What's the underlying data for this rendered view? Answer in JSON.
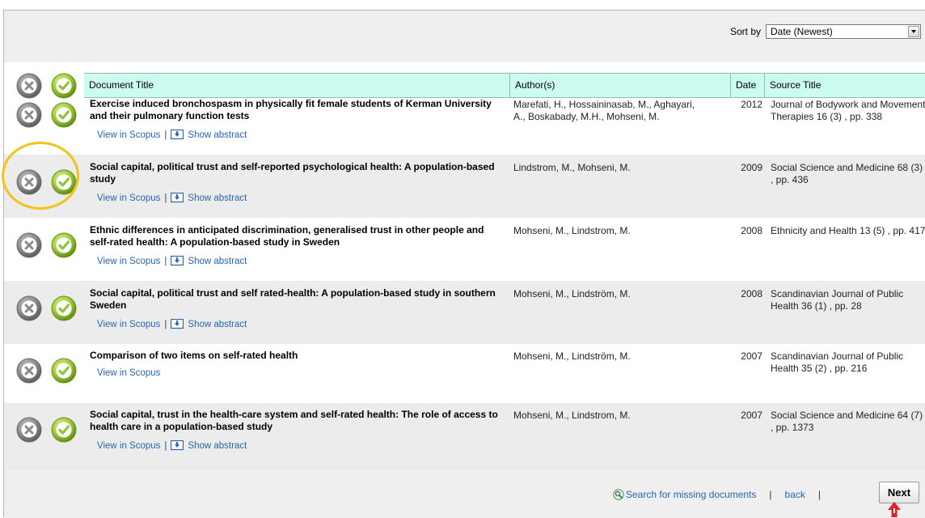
{
  "toolbar": {
    "sort_label": "Sort by",
    "sort_value": "Date (Newest)"
  },
  "table": {
    "headers": {
      "document_title": "Document Title",
      "authors": "Author(s)",
      "date": "Date",
      "source_title": "Source Title"
    },
    "rows": [
      {
        "title": "Exercise induced bronchospasm in physically fit female students of Kerman University and their pulmonary function tests",
        "authors": "Marefati, H., Hossaininasab, M., Aghayari, A., Boskabady, M.H., Mohseni, M.",
        "date": "2012",
        "source": "Journal of Bodywork and Movement Therapies 16 (3) , pp. 338",
        "view_link": "View in Scopus",
        "separator": "|",
        "abstract_link": "Show abstract"
      },
      {
        "title": "Social capital, political trust and self-reported psychological health: A population-based study",
        "authors": "Lindstrom, M., Mohseni, M.",
        "date": "2009",
        "source": "Social Science and Medicine 68 (3) , pp. 436",
        "view_link": "View in Scopus",
        "separator": "|",
        "abstract_link": "Show abstract"
      },
      {
        "title": "Ethnic differences in anticipated discrimination, generalised trust in other people and self-rated health: A population-based study in Sweden",
        "authors": "Mohseni, M., Lindstrom, M.",
        "date": "2008",
        "source": "Ethnicity and Health 13 (5) , pp. 417",
        "view_link": "View in Scopus",
        "separator": "|",
        "abstract_link": "Show abstract"
      },
      {
        "title": "Social capital, political trust and self rated-health: A population-based study in southern Sweden",
        "authors": "Mohseni, M., Lindström, M.",
        "date": "2008",
        "source": "Scandinavian Journal of Public Health 36 (1) , pp. 28",
        "view_link": "View in Scopus",
        "separator": "|",
        "abstract_link": "Show abstract"
      },
      {
        "title": "Comparison of two items on self-rated health",
        "authors": "Mohseni, M., Lindström, M.",
        "date": "2007",
        "source": "Scandinavian Journal of Public Health 35 (2) , pp. 216",
        "view_link": "View in Scopus"
      },
      {
        "title": "Social capital, trust in the health-care system and self-rated health: The role of access to health care in a population-based study",
        "authors": "Mohseni, M., Lindstrom, M.",
        "date": "2007",
        "source": "Social Science and Medicine 64 (7) , pp. 1373",
        "view_link": "View in Scopus",
        "separator": "|",
        "abstract_link": "Show abstract"
      }
    ]
  },
  "footer": {
    "search_missing": "Search for missing documents",
    "sep1": "|",
    "back": "back",
    "sep2": "|",
    "next": "Next"
  },
  "icons": {
    "reject": "reject-x-icon",
    "accept": "accept-check-icon",
    "abstract": "show-abstract-icon",
    "search": "magnifier-icon"
  },
  "colors": {
    "header_bg": "#ccfcf0",
    "link": "#2a64a8",
    "highlight": "#f3c31b",
    "accept_green": "#8fc23a"
  }
}
